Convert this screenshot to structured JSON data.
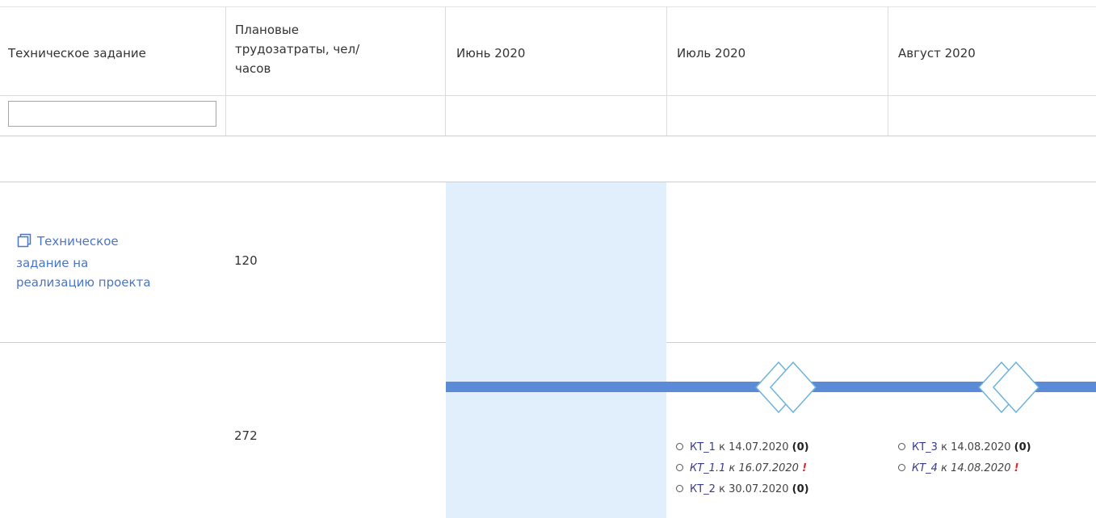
{
  "table": {
    "columns": [
      {
        "label": "Техническое задание"
      },
      {
        "label_lines": [
          "Плановые",
          "трудозатраты, чел/",
          "часов"
        ]
      },
      {
        "label": "Июнь 2020"
      },
      {
        "label": "Июль 2020"
      },
      {
        "label": "Август 2020"
      }
    ],
    "filter": {
      "value": "",
      "placeholder": ""
    },
    "rows": [
      {
        "title_lines": [
          "Техническое",
          "задание на",
          "реализацию проекта"
        ],
        "icon": "copy-icon",
        "planned_hours": "120"
      },
      {
        "planned_hours": "272"
      }
    ]
  },
  "timeline": {
    "current_month_highlight": "Июнь 2020",
    "bar_color": "#5b8ad6",
    "highlight_color": "#e1eefb",
    "milestone_groups": [
      {
        "month": "Июль 2020",
        "items": [
          {
            "name": "КТ_1",
            "date": "к 14.07.2020",
            "count": "(0)",
            "warn": ""
          },
          {
            "name": "КТ_1.1",
            "date": "к 16.07.2020",
            "count": "",
            "warn": "!"
          },
          {
            "name": "КТ_2",
            "date": "к 30.07.2020",
            "count": "(0)",
            "warn": ""
          }
        ]
      },
      {
        "month": "Август 2020",
        "items": [
          {
            "name": "КТ_3",
            "date": "к 14.08.2020",
            "count": "(0)",
            "warn": ""
          },
          {
            "name": "КТ_4",
            "date": "к 14.08.2020",
            "count": "",
            "warn": "!"
          }
        ]
      }
    ]
  }
}
